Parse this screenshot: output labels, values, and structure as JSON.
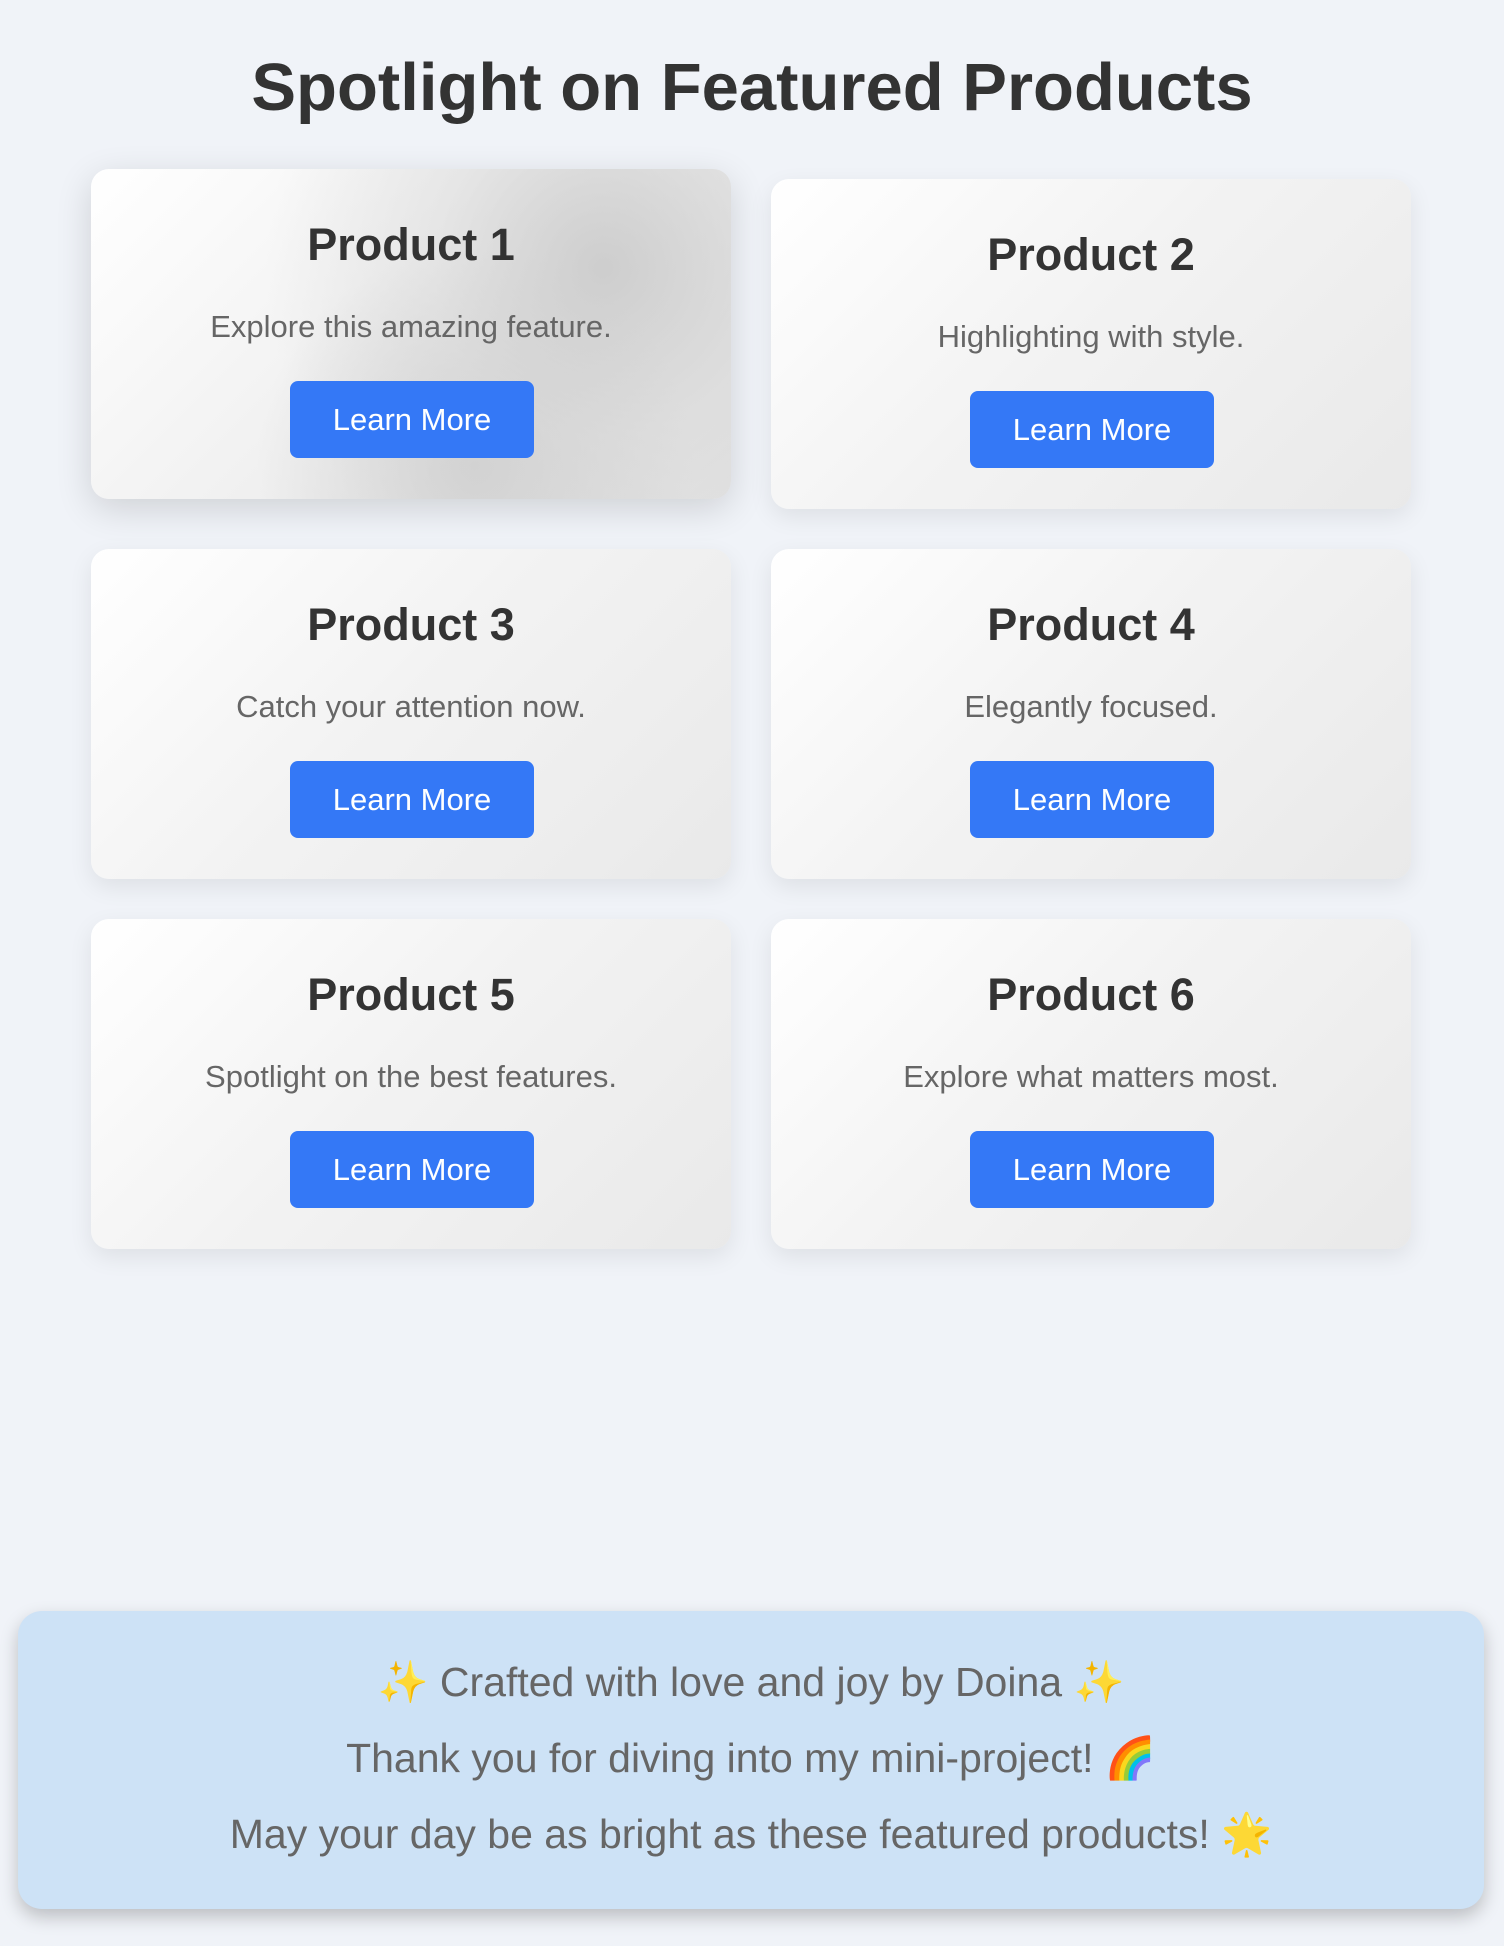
{
  "header": {
    "title": "Spotlight on Featured Products"
  },
  "products": [
    {
      "title": "Product 1",
      "description": "Explore this amazing feature.",
      "button_label": "Learn More"
    },
    {
      "title": "Product 2",
      "description": "Highlighting with style.",
      "button_label": "Learn More"
    },
    {
      "title": "Product 3",
      "description": "Catch your attention now.",
      "button_label": "Learn More"
    },
    {
      "title": "Product 4",
      "description": "Elegantly focused.",
      "button_label": "Learn More"
    },
    {
      "title": "Product 5",
      "description": "Spotlight on the best features.",
      "button_label": "Learn More"
    },
    {
      "title": "Product 6",
      "description": "Explore what matters most.",
      "button_label": "Learn More"
    }
  ],
  "footer": {
    "line1": "✨ Crafted with love and joy by Doina ✨",
    "line2": "Thank you for diving into my mini-project! 🌈",
    "line3": "May your day be as bright as these featured products! 🌟"
  },
  "colors": {
    "background": "#f0f3f8",
    "button": "#3478f6",
    "footer_background": "#cde2f6",
    "title_text": "#333333",
    "body_text": "#666666"
  }
}
